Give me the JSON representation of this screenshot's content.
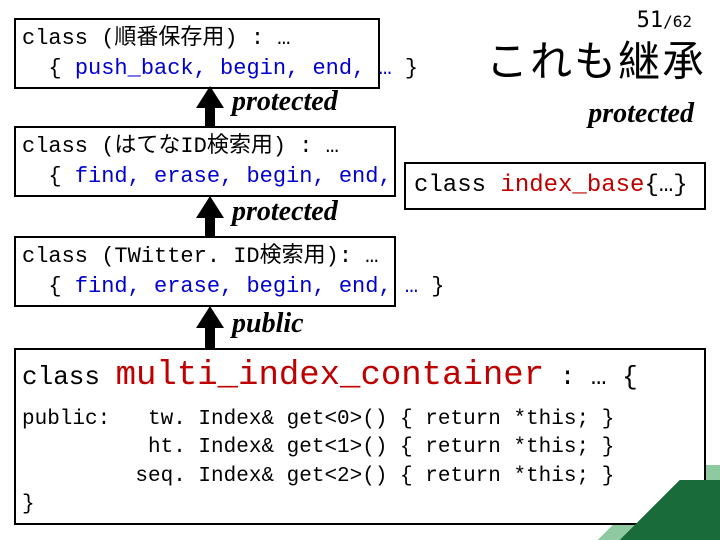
{
  "page": {
    "number": "51",
    "total": "/62"
  },
  "title": "これも継承",
  "boxes": {
    "seq": {
      "line1_a": "class (順番保存用) : …",
      "line2_a": "  { ",
      "line2_b": "push_back, begin, end, …",
      "line2_c": " }"
    },
    "hatena": {
      "line1_a": "class (はてなID検索用) : …",
      "line2_a": "  { ",
      "line2_b": "find, erase, begin, end, …",
      "line2_c": " }"
    },
    "twitter": {
      "line1_a": "class (TWitter. ID検索用): …",
      "line2_a": "  { ",
      "line2_b": "find, erase, begin, end, …",
      "line2_c": " }"
    },
    "index_base": {
      "a": "class ",
      "b": "index_base",
      "c": "{…}"
    },
    "multi": {
      "line1_a": "class ",
      "line1_b": "multi_index_container",
      "line1_c": " : … {",
      "body": "public:   tw. Index& get<0>() { return *this; }\n          ht. Index& get<1>() { return *this; }\n         seq. Index& get<2>() { return *this; }\n}"
    }
  },
  "labels": {
    "protected1": "protected",
    "protected2": "protected",
    "protected3": "protected",
    "public": "public"
  }
}
